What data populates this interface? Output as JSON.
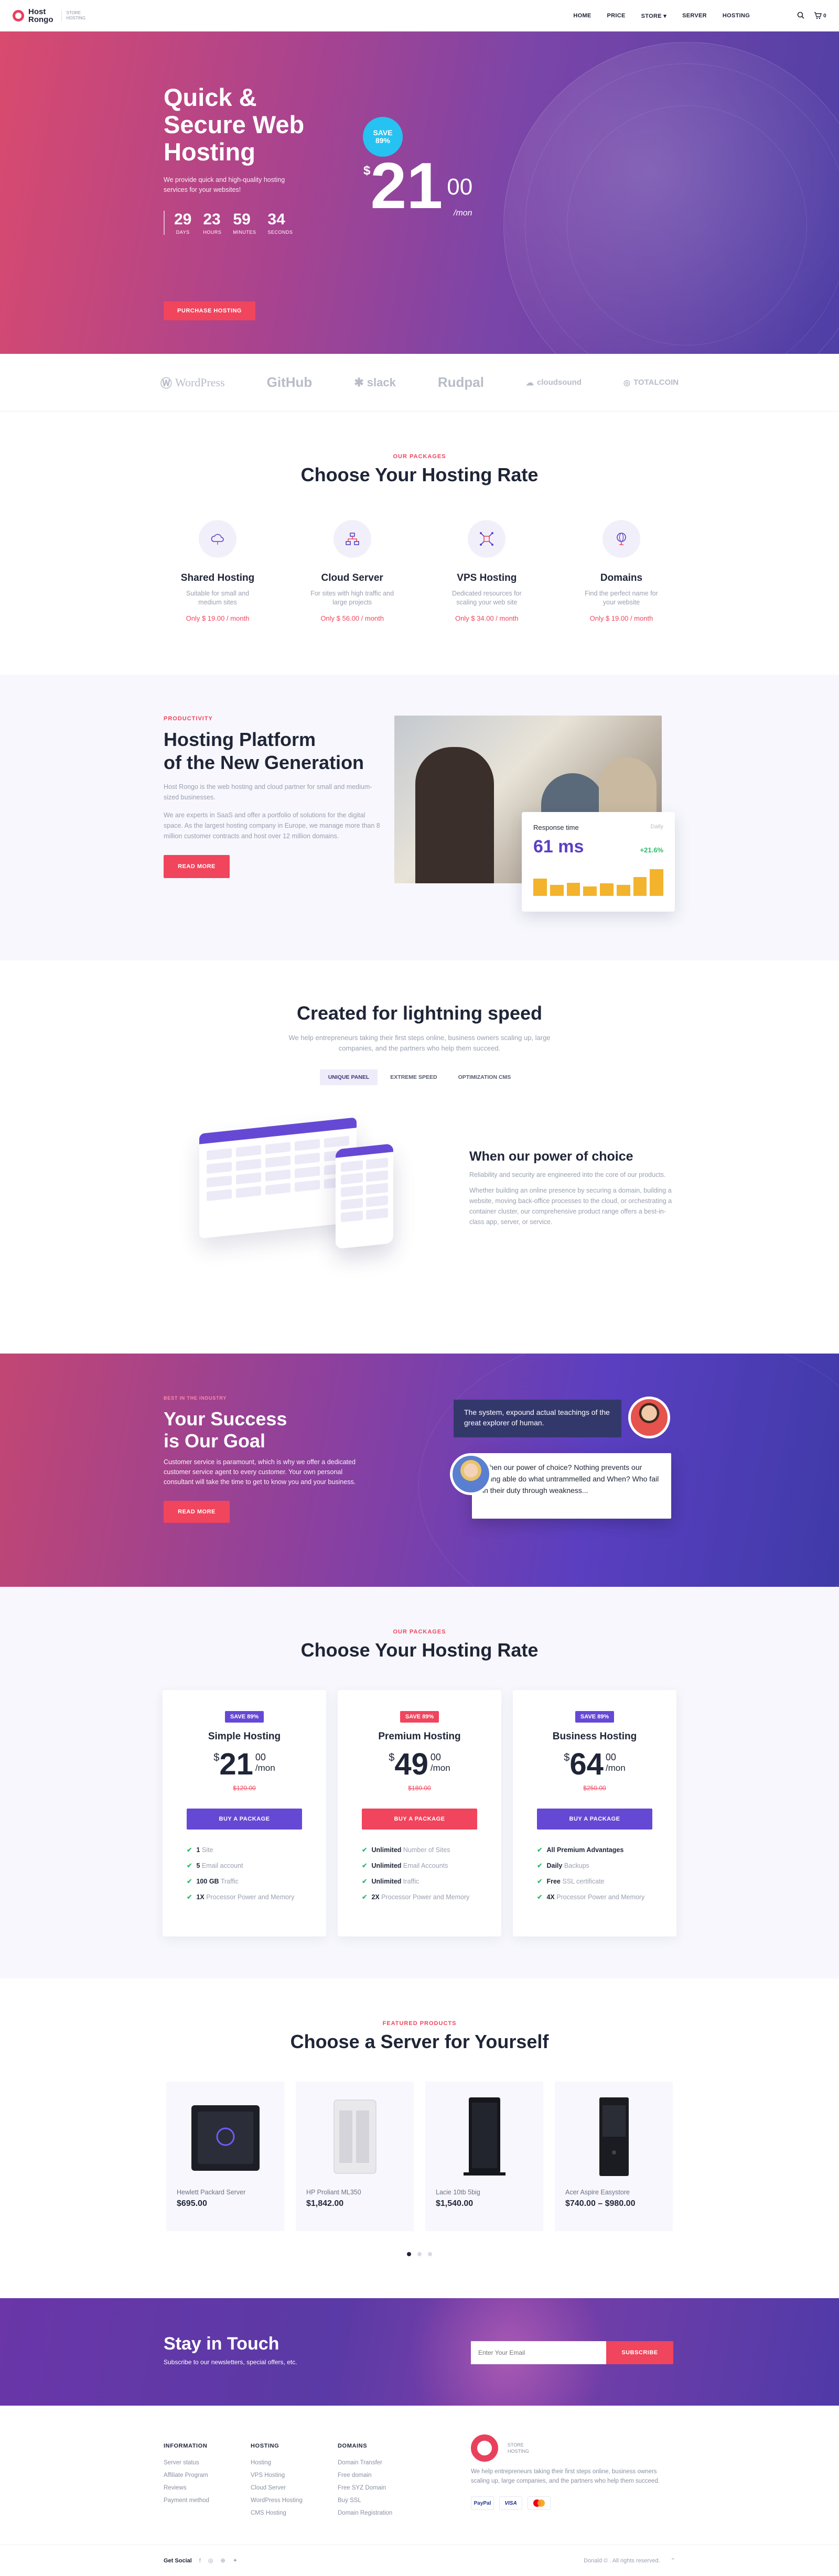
{
  "header": {
    "brand_line1": "Host",
    "brand_line2": "Rongo",
    "tagline_line1": "STORE",
    "tagline_line2": "HOSTING",
    "nav": [
      "HOME",
      "PRICE",
      "STORE",
      "SERVER",
      "HOSTING"
    ],
    "cart_count": "0"
  },
  "hero": {
    "title_line1": "Quick &",
    "title_line2": "Secure Web",
    "title_line3": "Hosting",
    "description": "We provide quick and high-quality hosting services for your websites!",
    "countdown": [
      {
        "value": "29",
        "label": "DAYS"
      },
      {
        "value": "23",
        "label": "HOURS"
      },
      {
        "value": "59",
        "label": "MINUTES"
      },
      {
        "value": "34",
        "label": "SECONDS"
      }
    ],
    "button": "PURCHASE HOSTING",
    "save_line1": "SAVE",
    "save_line2": "89%",
    "currency": "$",
    "price": "21",
    "cents": "00",
    "period": "/mon"
  },
  "partners": [
    "WordPress",
    "GitHub",
    "slack",
    "Rudpal",
    "cloudsound",
    "TOTALCOIN"
  ],
  "rate": {
    "kicker": "OUR PACKAGES",
    "title": "Choose Your Hosting Rate",
    "items": [
      {
        "icon": "cloud-icon",
        "name": "Shared Hosting",
        "desc": "Suitable for small and medium sites",
        "price": "Only $ 19.00 / month"
      },
      {
        "icon": "network-icon",
        "name": "Cloud Server",
        "desc": "For sites with high traffic and large projects",
        "price": "Only $ 56.00 / month"
      },
      {
        "icon": "vps-icon",
        "name": "VPS Hosting",
        "desc": "Dedicated resources for scaling your web site",
        "price": "Only $ 34.00 / month"
      },
      {
        "icon": "domain-icon",
        "name": "Domains",
        "desc": "Find the perfect name for your website",
        "price": "Only $ 19.00 / month"
      }
    ]
  },
  "platform": {
    "kicker": "PRODUCTIVITY",
    "title_line1": "Hosting Platform",
    "title_line2": "of the New Generation",
    "para1": "Host Rongo is the web hosting and cloud partner for small and medium-sized businesses.",
    "para2": "We are experts in SaaS and offer a portfolio of solutions for the digital space. As the largest hosting company in Europe, we manage more than 8 million customer contracts and host over 12 million domains.",
    "button": "READ MORE",
    "response_title": "Response time",
    "response_period": "Daily",
    "response_value": "61 ms",
    "response_change": "+21.6%",
    "bars": [
      0.55,
      0.35,
      0.42,
      0.3,
      0.4,
      0.35,
      0.6,
      0.85
    ]
  },
  "speed": {
    "title": "Created for lightning speed",
    "description": "We help entrepreneurs taking their first steps online, business owners scaling up, large companies, and the partners who help them succeed.",
    "tabs": [
      "UNIQUE PANEL",
      "EXTREME SPEED",
      "OPTIMIZATION CMS"
    ],
    "active_tab": "UNIQUE PANEL",
    "right_title": "When our power of choice",
    "right_p1": "Reliability and security are engineered into the core of our products.",
    "right_p2": "Whether building an online presence by securing a domain, building a website, moving back-office processes to the cloud, or orchestrating a container cluster, our comprehensive product range offers a best-in-class app, server, or service."
  },
  "success": {
    "kicker": "BEST IN THE INDUSTRY",
    "title_line1": "Your Success",
    "title_line2": "is Our Goal",
    "description": "Customer service is paramount, which is why we offer a dedicated customer service agent to every customer. Your own personal consultant will take the time to get to know you and your business.",
    "button": "READ MORE",
    "bubble1": "The system, expound actual teachings of the great explorer of human.",
    "bubble2": "When our power of choice? Nothing prevents our being able do what untrammelled and When? Who fail in their duty through weakness..."
  },
  "pricing": {
    "kicker": "OUR PACKAGES",
    "title": "Choose Your Hosting Rate",
    "plans": [
      {
        "save": "SAVE 89%",
        "save_color": "#6549d5",
        "name": "Simple Hosting",
        "currency": "$",
        "price": "21",
        "cents": "00",
        "period": "/mon",
        "old": "$120.00",
        "button": "BUY A PACKAGE",
        "button_color": "#6549d5",
        "features": [
          {
            "b": "1",
            "t": " Site"
          },
          {
            "b": "5",
            "t": " Email account"
          },
          {
            "b": "100 GB",
            "t": " Traffic"
          },
          {
            "b": "1X",
            "t": " Processor Power and Memory"
          }
        ]
      },
      {
        "save": "SAVE 89%",
        "save_color": "#f0455d",
        "name": "Premium Hosting",
        "currency": "$",
        "price": "49",
        "cents": "00",
        "period": "/mon",
        "old": "$180.00",
        "button": "BUY A PACKAGE",
        "button_color": "#f0455d",
        "features": [
          {
            "b": "Unlimited",
            "t": " Number of Sites"
          },
          {
            "b": "Unlimited",
            "t": " Email Accounts"
          },
          {
            "b": "Unlimited",
            "t": " traffic"
          },
          {
            "b": "2X",
            "t": " Processor Power and Memory"
          }
        ]
      },
      {
        "save": "SAVE 89%",
        "save_color": "#6549d5",
        "name": "Business Hosting",
        "currency": "$",
        "price": "64",
        "cents": "00",
        "period": "/mon",
        "old": "$250.00",
        "button": "BUY A PACKAGE",
        "button_color": "#6549d5",
        "features": [
          {
            "b": "All Premium Advantages",
            "t": ""
          },
          {
            "b": "Daily",
            "t": " Backups"
          },
          {
            "b": "Free",
            "t": " SSL certificate"
          },
          {
            "b": "4X",
            "t": " Processor Power and Memory"
          }
        ]
      }
    ]
  },
  "servers": {
    "kicker": "FEATURED PRODUCTS",
    "title": "Choose a Server for Yourself",
    "items": [
      {
        "name": "Hewlett Packard Server",
        "price": "$695.00"
      },
      {
        "name": "HP Proliant ML350",
        "price": "$1,842.00"
      },
      {
        "name": "Lacie 10tb 5big",
        "price": "$1,540.00"
      },
      {
        "name": "Acer Aspire Easystore",
        "price": "$740.00 – $980.00"
      }
    ]
  },
  "newsletter": {
    "title": "Stay in Touch",
    "subtitle": "Subscribe to our newsletters, special offers, etc.",
    "placeholder": "Enter Your Email",
    "button": "SUBSCRIBE"
  },
  "footer": {
    "columns": [
      {
        "title": "INFORMATION",
        "links": [
          "Server status",
          "Affiliate Program",
          "Reviews",
          "Payment method"
        ]
      },
      {
        "title": "HOSTING",
        "links": [
          "Hosting",
          "VPS Hosting",
          "Cloud Server",
          "WordPress Hosting",
          "CMS Hosting"
        ]
      },
      {
        "title": "DOMAINS",
        "links": [
          "Domain Transfer",
          "Free domain",
          "Free SYZ Domain",
          "Buy SSL",
          "Domain Registration"
        ]
      }
    ],
    "about": "We help entrepreneurs taking their first steps online, business owners scaling up, large companies, and the partners who help them succeed.",
    "logo_sub1": "STORE",
    "logo_sub2": "HOSTING",
    "payments": [
      "PayPal",
      "VISA",
      "MC"
    ],
    "social_label": "Get Social",
    "copyright": "Donald © . All rights reserved."
  }
}
